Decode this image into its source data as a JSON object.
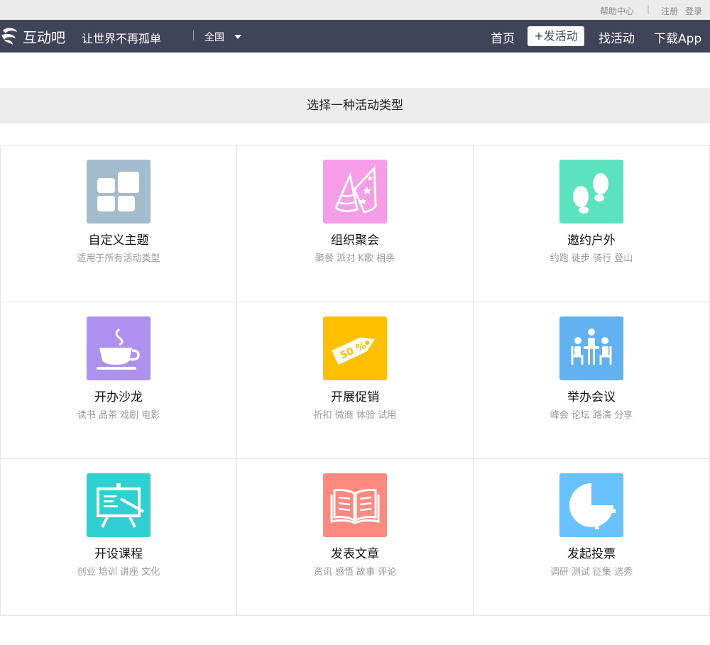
{
  "topbar": {
    "help": "帮助中心",
    "separator": "|",
    "register": "注册",
    "login": "登录"
  },
  "navbar": {
    "logo_text": "互动吧",
    "slogan": "让世界不再孤单",
    "city": "全国",
    "links": {
      "home": "首页",
      "post": "+发活动",
      "find": "找活动",
      "app": "下载App"
    }
  },
  "section": {
    "title": "选择一种活动类型"
  },
  "categories": [
    {
      "title": "自定义主题",
      "sub": "适用于所有活动类型",
      "icon": "grid-icon",
      "color": "#a3bccb"
    },
    {
      "title": "组织聚会",
      "sub": "聚餐 派对 K歌 相亲",
      "icon": "party-hat-icon",
      "color": "#f59de6"
    },
    {
      "title": "邀约户外",
      "sub": "约跑 徒步 骑行 登山",
      "icon": "footprints-icon",
      "color": "#5ae3bd"
    },
    {
      "title": "开办沙龙",
      "sub": "读书 品茶 戏剧 电影",
      "icon": "coffee-cup-icon",
      "color": "#ae90ee"
    },
    {
      "title": "开展促销",
      "sub": "折扣 微商 体验 试用",
      "icon": "price-tag-icon",
      "color": "#fec001",
      "tag_text": "50 %"
    },
    {
      "title": "举办会议",
      "sub": "峰会 论坛 路演 分享",
      "icon": "meeting-icon",
      "color": "#62b2f1"
    },
    {
      "title": "开设课程",
      "sub": "创业 培训 讲座 文化",
      "icon": "easel-icon",
      "color": "#2fd0cf"
    },
    {
      "title": "发表文章",
      "sub": "资讯 感悟 故事 评论",
      "icon": "book-icon",
      "color": "#fe8a7f"
    },
    {
      "title": "发起投票",
      "sub": "调研 测试 征集 选秀",
      "icon": "pie-chart-icon",
      "color": "#67c2fd"
    }
  ]
}
